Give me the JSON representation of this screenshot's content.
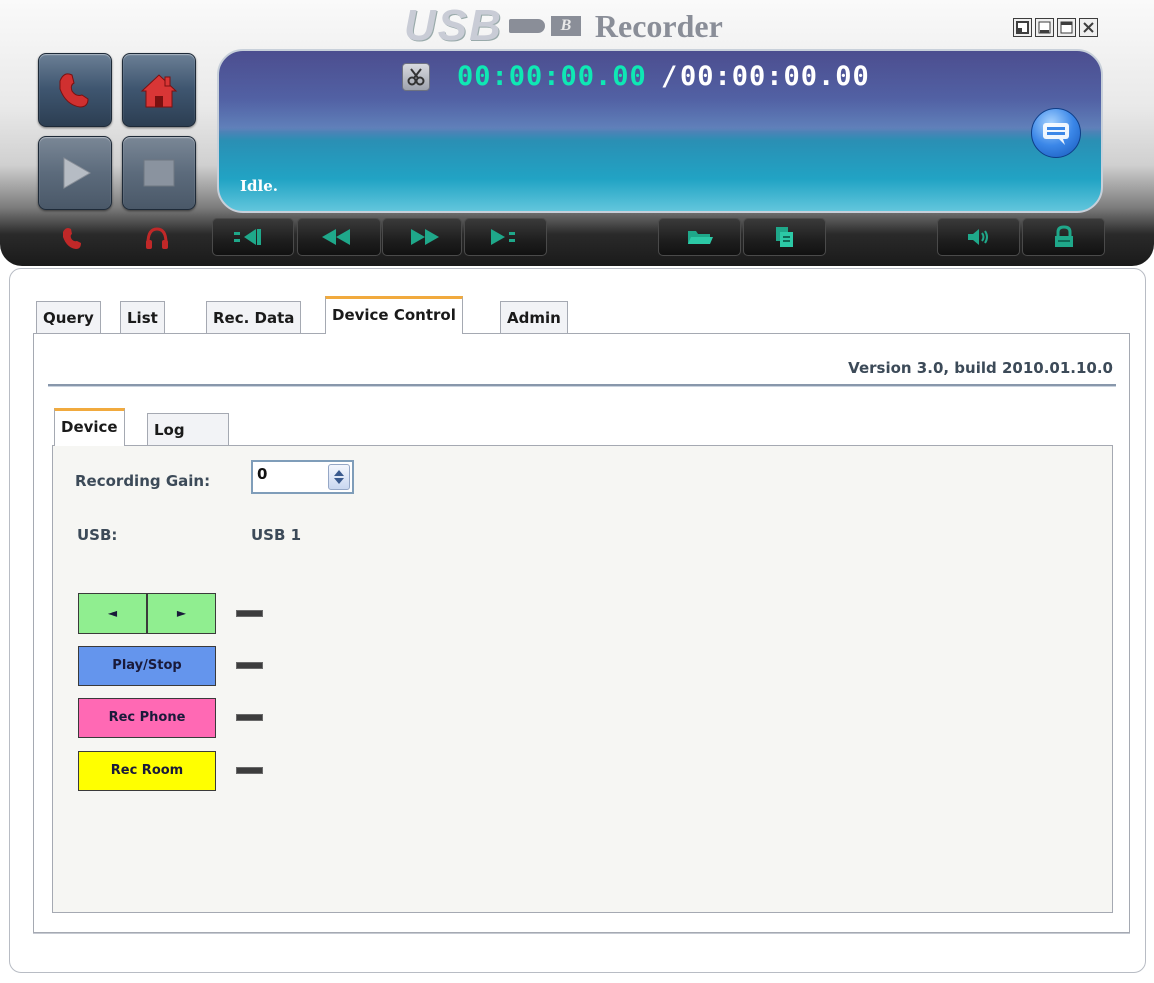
{
  "app": {
    "logo_usb": "USB",
    "logo_b": "B",
    "logo_text": "Recorder"
  },
  "window_controls": [
    "restore-icon",
    "minimize-icon",
    "maximize-icon",
    "close-icon"
  ],
  "player": {
    "time_current": "00:00:00.00",
    "time_separator": "/",
    "time_total": "00:00:00.00",
    "status": "Idle."
  },
  "tabs": [
    "Query",
    "List",
    "Rec. Data",
    "Device Control",
    "Admin"
  ],
  "active_tab": "Device Control",
  "version": "Version 3.0, build 2010.01.10.0",
  "subtabs": [
    "Device",
    "Log"
  ],
  "active_subtab": "Device",
  "device": {
    "gain_label": "Recording Gain:",
    "gain_value": "0",
    "usb_label": "USB:",
    "usb_value": "USB 1",
    "nav_prev_label": "◄",
    "nav_next_label": "►",
    "play_stop_label": "Play/Stop",
    "rec_phone_label": "Rec Phone",
    "rec_room_label": "Rec Room"
  },
  "colors": {
    "accent_tab": "#f1aa3e",
    "nav_button": "#90ee90",
    "play_stop_button": "#6495ed",
    "rec_phone_button": "#ff69b4",
    "rec_room_button": "#ffff00",
    "time_current": "#0fe8b4"
  }
}
